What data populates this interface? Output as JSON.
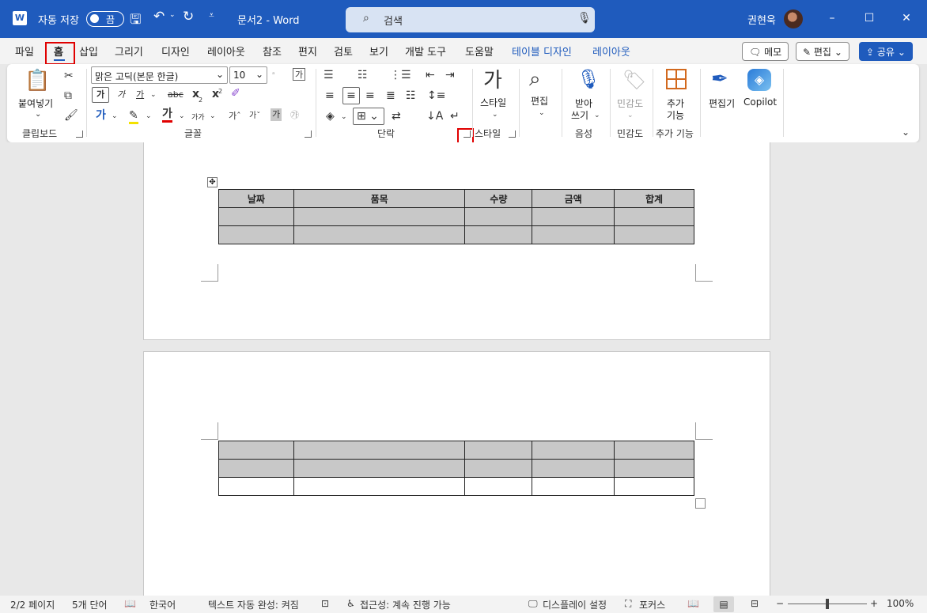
{
  "titlebar": {
    "app_icon": "word-app-icon",
    "autosave_label": "자동 저장",
    "autosave_state": "끔",
    "doc_title": "문서2  -  Word",
    "search_placeholder": "검색",
    "user_name": "권현욱"
  },
  "tabs": [
    "파일",
    "홈",
    "삽입",
    "그리기",
    "디자인",
    "레이아웃",
    "참조",
    "편지",
    "검토",
    "보기",
    "개발 도구",
    "도움말",
    "테이블 디자인",
    "레이아웃"
  ],
  "right_buttons": {
    "memo": "메모",
    "edit": "편집",
    "share": "공유"
  },
  "ribbon": {
    "clipboard": {
      "paste": "붙여넣기",
      "group": "클립보드"
    },
    "font": {
      "name": "맑은 고딕(본문 한글)",
      "size": "10",
      "group": "글꼴",
      "btn_ga": "가",
      "btn_ga2": "가",
      "btn_ga3": "가",
      "btn_gaga": "가가",
      "btn_x2": "x",
      "btn_x2b": "x"
    },
    "paragraph": {
      "group": "단락"
    },
    "styles": {
      "label": "스타일",
      "group": "스타일"
    },
    "editing": {
      "label": "편집"
    },
    "voice": {
      "label1": "받아",
      "label2": "쓰기",
      "group": "음성"
    },
    "sensitivity": {
      "label": "민감도",
      "group": "민감도"
    },
    "addins": {
      "label1": "추가",
      "label2": "기능",
      "group": "추가 기능"
    },
    "editor": {
      "label": "편집기"
    },
    "copilot": {
      "label": "Copilot"
    }
  },
  "table": {
    "headers": [
      "날짜",
      "품목",
      "수량",
      "금액",
      "합계"
    ]
  },
  "status": {
    "page": "2/2 페이지",
    "words": "5개 단어",
    "language": "한국어",
    "autocomplete": "텍스트 자동 완성: 켜짐",
    "accessibility": "접근성: 계속 진행 가능",
    "display": "디스플레이 설정",
    "focus": "포커스",
    "zoom": "100%"
  }
}
